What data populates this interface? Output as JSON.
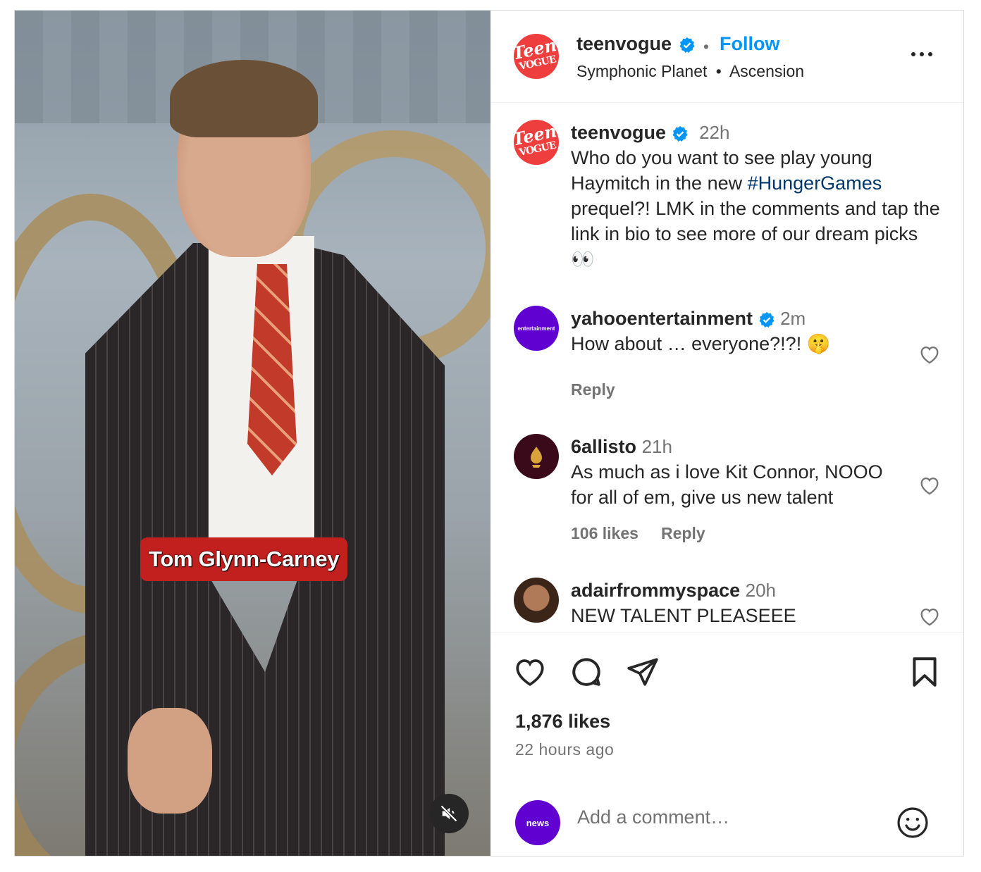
{
  "media": {
    "caption": "Tom Glynn-Carney"
  },
  "header": {
    "username": "teenvogue",
    "follow_label": "Follow",
    "separator": "•",
    "audio": "Symphonic Planet",
    "audio_sep": "•",
    "audio_artist": "Ascension",
    "avatar_text_1": "Teen",
    "avatar_text_2": "VOGUE"
  },
  "post": {
    "username": "teenvogue",
    "time": "22h",
    "text_before": "Who do you want to see play young Haymitch in the new ",
    "hashtag": "#HungerGames",
    "text_after": " prequel?! LMK in the comments and tap the link in bio to see more of our dream picks 👀"
  },
  "comments": [
    {
      "username": "yahooentertainment",
      "verified": true,
      "time": "2m",
      "text": "How about … everyone?!?! 🤫",
      "likes": "",
      "reply": "Reply",
      "avatar_label": "entertainment"
    },
    {
      "username": "6allisto",
      "verified": false,
      "time": "21h",
      "text": "As much as i love Kit Connor, NOOO for all of em, give us new talent",
      "likes": "106 likes",
      "reply": "Reply"
    },
    {
      "username": "adairfrommyspace",
      "verified": false,
      "time": "20h",
      "text": "NEW TALENT PLEASEEE"
    }
  ],
  "footer": {
    "likes": "1,876 likes",
    "time_ago": "22 hours ago",
    "add_comment_placeholder": "Add a comment…",
    "own_avatar_label": "news"
  },
  "colors": {
    "link_blue": "#0095f6",
    "verified_blue": "#0095f6",
    "hashtag": "#00376b",
    "teenvogue_red": "#ef3e3e",
    "yahoo_purple": "#6001d2",
    "caption_red": "#c21f1f"
  },
  "icons": [
    "verified-badge-icon",
    "more-options-icon",
    "heart-icon",
    "comment-icon",
    "share-icon",
    "bookmark-icon",
    "mute-icon",
    "emoji-icon"
  ]
}
